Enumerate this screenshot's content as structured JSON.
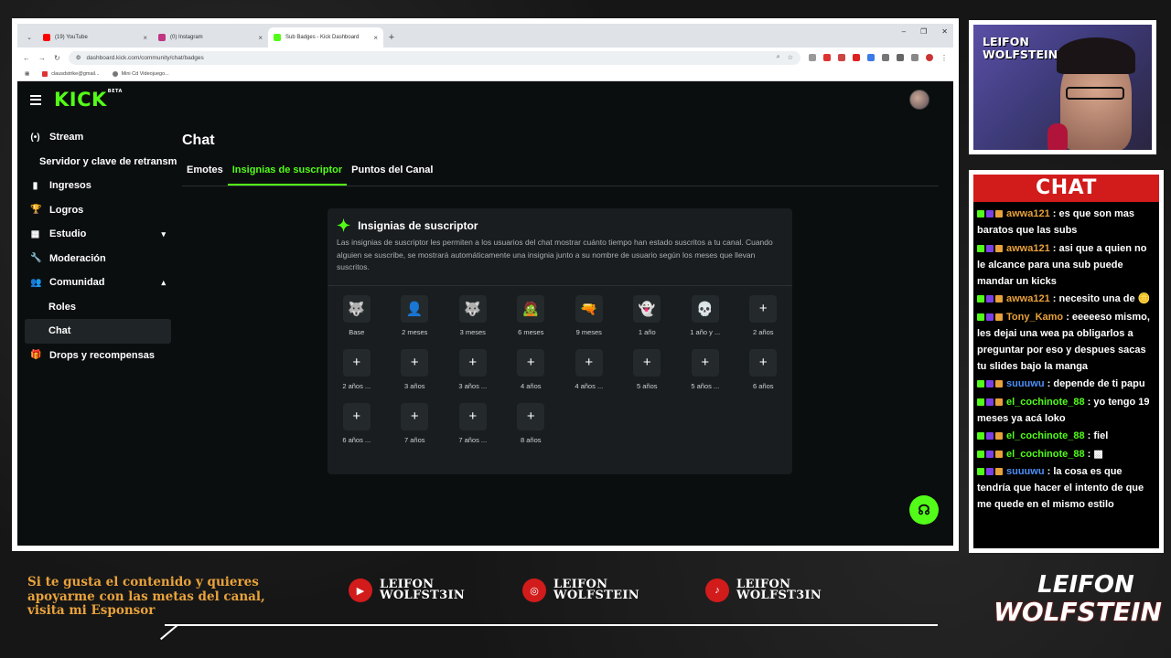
{
  "browser": {
    "tabs": [
      {
        "label": "(19) YouTube",
        "color": "#ff0000"
      },
      {
        "label": "(0) Instagram",
        "color": "#c13584"
      },
      {
        "label": "Sub Badges - Kick Dashboard",
        "color": "#53fc18"
      }
    ],
    "url": "dashboard.kick.com/community/chat/badges",
    "bookmarks": [
      "clausdstrike@gmail...",
      "Mini Cd Videojuego..."
    ]
  },
  "kick": {
    "logo": "KICK",
    "logo_sup": "BETA",
    "sidebar": [
      {
        "label": "Stream",
        "icon": "(•)"
      },
      {
        "label": "Servidor y clave de retransm",
        "icon": ""
      },
      {
        "label": "Ingresos",
        "icon": "▮"
      },
      {
        "label": "Logros",
        "icon": "🏆"
      },
      {
        "label": "Estudio",
        "icon": "▦",
        "chev": "▾"
      },
      {
        "label": "Moderación",
        "icon": "🔧"
      },
      {
        "label": "Comunidad",
        "icon": "👥",
        "chev": "▴"
      },
      {
        "label": "Roles",
        "icon": ""
      },
      {
        "label": "Chat",
        "icon": ""
      },
      {
        "label": "Drops y recompensas",
        "icon": "🎁"
      }
    ],
    "page_title": "Chat",
    "tabs": [
      "Emotes",
      "Insignias de suscriptor",
      "Puntos del Canal"
    ],
    "card": {
      "title": "Insignias de suscriptor",
      "description": "Las insignias de suscriptor les permiten a los usuarios del chat mostrar cuánto tiempo han estado suscritos a tu canal. Cuando alguien se suscribe, se mostrará automáticamente una insignia junto a su nombre de usuario según los meses que llevan suscritos."
    },
    "badges": [
      {
        "label": "Base",
        "icon": "🐺"
      },
      {
        "label": "2 meses",
        "icon": "👤"
      },
      {
        "label": "3 meses",
        "icon": "🐺"
      },
      {
        "label": "6 meses",
        "icon": "🧟"
      },
      {
        "label": "9 meses",
        "icon": "🔫"
      },
      {
        "label": "1 año",
        "icon": "👻"
      },
      {
        "label": "1 año y ...",
        "icon": "💀"
      },
      {
        "label": "2 años",
        "icon": "+"
      },
      {
        "label": "2 años ...",
        "icon": "+"
      },
      {
        "label": "3 años",
        "icon": "+"
      },
      {
        "label": "3 años ...",
        "icon": "+"
      },
      {
        "label": "4 años",
        "icon": "+"
      },
      {
        "label": "4 años ...",
        "icon": "+"
      },
      {
        "label": "5 años",
        "icon": "+"
      },
      {
        "label": "5 años ...",
        "icon": "+"
      },
      {
        "label": "6 años",
        "icon": "+"
      },
      {
        "label": "6 años ...",
        "icon": "+"
      },
      {
        "label": "7 años",
        "icon": "+"
      },
      {
        "label": "7 años ...",
        "icon": "+"
      },
      {
        "label": "8 años",
        "icon": "+"
      }
    ]
  },
  "cam": {
    "name_line1": "LEIFON",
    "name_line2": "WOLFSTEIN"
  },
  "chat": {
    "title": "CHAT",
    "messages": [
      {
        "user": "awwa121",
        "color": "#e9a23b",
        "text": "es que son mas baratos que las subs"
      },
      {
        "user": "awwa121",
        "color": "#e9a23b",
        "text": "asi que a quien no le alcance para una sub puede mandar un kicks"
      },
      {
        "user": "awwa121",
        "color": "#e9a23b",
        "text": "necesito una de 🪙"
      },
      {
        "user": "Tony_Kamo",
        "color": "#e9a23b",
        "text": "eeeeeso mismo, les dejai una wea pa obligarlos a preguntar por eso y despues sacas tu slides bajo la manga"
      },
      {
        "user": "suuuwu",
        "color": "#4f8ff7",
        "text": "depende de ti papu"
      },
      {
        "user": "el_cochinote_88",
        "color": "#53fc18",
        "text": "yo tengo 19 meses ya acá loko"
      },
      {
        "user": "el_cochinote_88",
        "color": "#53fc18",
        "text": "fiel"
      },
      {
        "user": "el_cochinote_88",
        "color": "#53fc18",
        "text": "▩"
      },
      {
        "user": "suuuwu",
        "color": "#4f8ff7",
        "text": "la cosa es que tendría que hacer el intento de que me quede en el mismo estilo"
      }
    ]
  },
  "overlay": {
    "promo": [
      "Si te gusta el contenido y quieres",
      "apoyarme con las metas del canal,",
      "visita mi Esponsor"
    ],
    "socials": [
      {
        "icon": "▶",
        "l1": "LEIFON",
        "l2": "WOLFST3IN"
      },
      {
        "icon": "◎",
        "l1": "LEIFON",
        "l2": "WOLFSTEIN"
      },
      {
        "icon": "♪",
        "l1": "LEIFON",
        "l2": "WOLFST3IN"
      }
    ],
    "brand": [
      "LEIFON",
      "WOLFSTEIN"
    ]
  }
}
